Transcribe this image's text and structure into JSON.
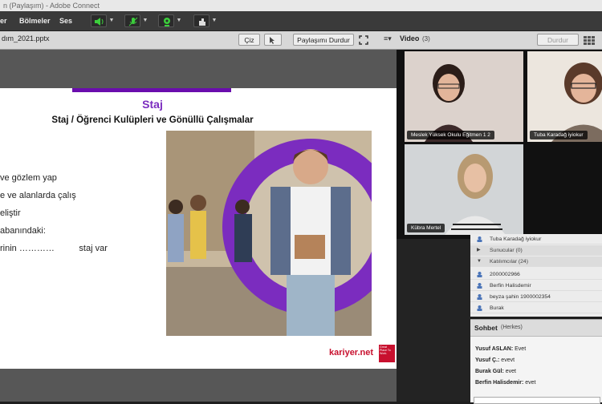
{
  "window": {
    "title": "n (Paylaşım) - Adobe Connect"
  },
  "menubar": {
    "items": [
      "er",
      "Bölmeler",
      "Ses"
    ]
  },
  "share": {
    "filename": "dım_2021.pptx",
    "zoom_label": "Çiz",
    "stop_label": "Paylaşımı Durdur",
    "menu_icon": "≡▾"
  },
  "slide": {
    "title": "Staj",
    "subtitle": "Staj / Öğrenci Kulüpleri ve Gönüllü Çalışmalar",
    "bullets": [
      " ve gözlem yap",
      "e ve alanlarda çalış",
      "eliştir",
      "abanındaki:",
      "rinin …………          staj var"
    ],
    "logo_text": "kariyer.net",
    "badge_text": "Great Place To Work.",
    "accent_color": "#7b2cbf",
    "bar_color": "#6a0dad"
  },
  "video": {
    "header": "Video",
    "count": "(3)",
    "stop_label": "Durdur",
    "tiles": [
      {
        "label": "Meslek Yüksek Okulu Eğitmen 1 2"
      },
      {
        "label": "Tuba Karadağ iyiokur"
      },
      {
        "label": "Kübra Mertel"
      }
    ]
  },
  "attendees": {
    "rows": [
      {
        "text": "Tuba Karadağ iyiokur",
        "type": "person"
      },
      {
        "text": "Sunucular (0)",
        "type": "group"
      },
      {
        "text": "Katılımcılar (24)",
        "type": "group"
      },
      {
        "text": "2000002966",
        "type": "person"
      },
      {
        "text": "Berfin Halisdemir",
        "type": "person"
      },
      {
        "text": "beyza şahin 1900002354",
        "type": "person"
      },
      {
        "text": "Burak",
        "type": "person"
      }
    ]
  },
  "chat": {
    "title": "Sohbet",
    "scope": "(Herkes)",
    "messages": [
      {
        "name": "Yusuf ASLAN:",
        "text": "Evet"
      },
      {
        "name": "Yusuf Ç.:",
        "text": "evevt"
      },
      {
        "name": "Burak Gül:",
        "text": "evet"
      },
      {
        "name": "Berfin Halisdemir:",
        "text": "evet"
      }
    ]
  }
}
